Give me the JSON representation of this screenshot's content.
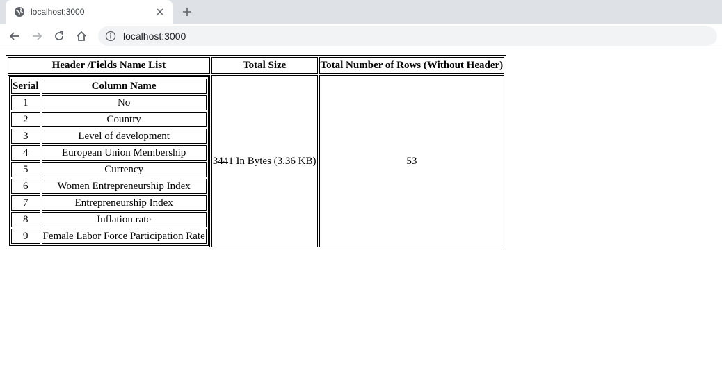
{
  "browser": {
    "tab_title": "localhost:3000",
    "url": "localhost:3000"
  },
  "table": {
    "headers": {
      "fields": "Header /Fields Name List",
      "size": "Total Size",
      "rows": "Total Number of Rows (Without Header)"
    },
    "inner_headers": {
      "serial": "Serial",
      "column_name": "Column Name"
    },
    "fields": [
      {
        "serial": "1",
        "name": "No"
      },
      {
        "serial": "2",
        "name": "Country"
      },
      {
        "serial": "3",
        "name": "Level of development"
      },
      {
        "serial": "4",
        "name": "European Union Membership"
      },
      {
        "serial": "5",
        "name": "Currency"
      },
      {
        "serial": "6",
        "name": "Women Entrepreneurship Index"
      },
      {
        "serial": "7",
        "name": "Entrepreneurship Index"
      },
      {
        "serial": "8",
        "name": "Inflation rate"
      },
      {
        "serial": "9",
        "name": "Female Labor Force Participation Rate"
      }
    ],
    "total_size": "3441 In Bytes (3.36 KB)",
    "total_rows": "53"
  }
}
